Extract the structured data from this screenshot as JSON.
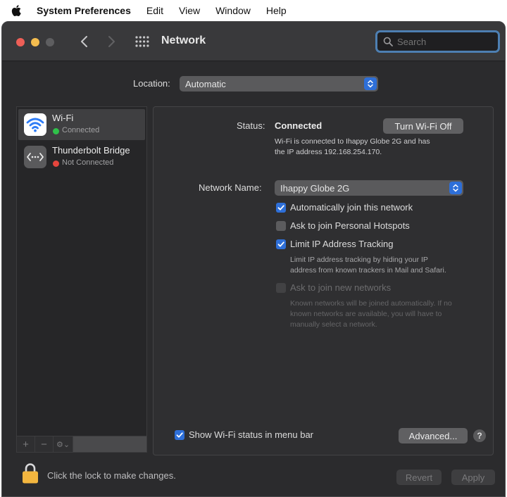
{
  "menubar": {
    "app_name": "System Preferences",
    "items": [
      "Edit",
      "View",
      "Window",
      "Help"
    ]
  },
  "window": {
    "title": "Network",
    "search_placeholder": "Search"
  },
  "location": {
    "label": "Location:",
    "value": "Automatic"
  },
  "services": [
    {
      "name": "Wi-Fi",
      "status": "Connected",
      "status_color": "#2fc14a",
      "icon": "wifi-icon"
    },
    {
      "name": "Thunderbolt Bridge",
      "status": "Not Connected",
      "status_color": "#e5453d",
      "icon": "thunderbolt-bridge-icon"
    }
  ],
  "sidebar_tools": {
    "add": "+",
    "remove": "−",
    "action": "⚙︎⌄"
  },
  "detail": {
    "status_label": "Status:",
    "status_value": "Connected",
    "turn_off_button": "Turn Wi-Fi Off",
    "status_desc_1": "Wi-Fi is connected to Ihappy Globe 2G and has",
    "status_desc_2": "the IP address 192.168.254.170.",
    "network_name_label": "Network Name:",
    "network_name_value": "Ihappy Globe 2G",
    "checkboxes": {
      "auto_join": {
        "label": "Automatically join this network",
        "checked": true
      },
      "ask_hotspots": {
        "label": "Ask to join Personal Hotspots",
        "checked": false
      },
      "limit_ip": {
        "label": "Limit IP Address Tracking",
        "checked": true
      },
      "ask_new": {
        "label": "Ask to join new networks",
        "checked": false,
        "disabled": true
      }
    },
    "limit_ip_desc_1": "Limit IP address tracking by hiding your IP",
    "limit_ip_desc_2": "address from known trackers in Mail and Safari.",
    "ask_new_desc_1": "Known networks will be joined automatically. If no",
    "ask_new_desc_2": "known networks are available, you will have to",
    "ask_new_desc_3": "manually select a network.",
    "show_status_label": "Show Wi-Fi status in menu bar",
    "advanced_button": "Advanced...",
    "help_button": "?"
  },
  "footer": {
    "lock_text": "Click the lock to make changes.",
    "revert_button": "Revert",
    "apply_button": "Apply"
  },
  "colors": {
    "accent": "#2e6fd8",
    "window_bg": "#2b2b2d",
    "lock": "#f3b63f"
  }
}
